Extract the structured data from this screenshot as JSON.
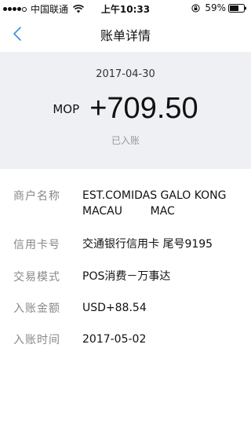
{
  "status_bar": {
    "carrier": "中国联通",
    "time": "上午10:33",
    "battery": "59%"
  },
  "nav": {
    "title": "账单详情",
    "back_icon": "chevron-left-icon"
  },
  "summary": {
    "date": "2017-04-30",
    "currency": "MOP",
    "amount": "+709.50",
    "status": "已入账"
  },
  "details": [
    {
      "label": "商户名称",
      "value_line1": "EST.COMIDAS GALO KONG",
      "value_line2": "MACAU        MAC"
    },
    {
      "label": "信用卡号",
      "value": "交通银行信用卡 尾号9195"
    },
    {
      "label": "交易模式",
      "value": "POS消费－万事达"
    },
    {
      "label": "入账金额",
      "value": "USD+88.54"
    },
    {
      "label": "入账时间",
      "value": "2017-05-02"
    }
  ],
  "colors": {
    "accent": "#3b8de0",
    "summary_bg": "#eff0f4",
    "label": "#888888"
  }
}
